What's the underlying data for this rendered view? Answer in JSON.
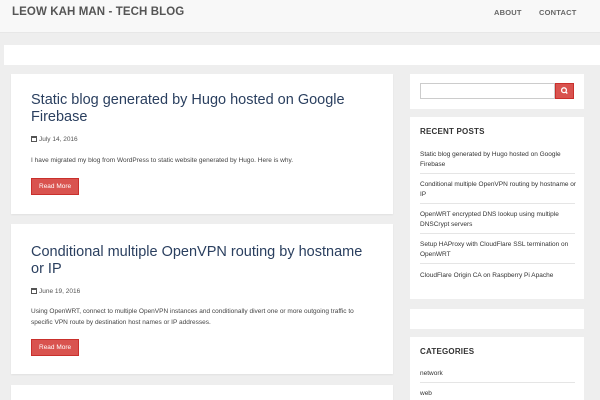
{
  "navbar": {
    "brand": "LEOW KAH MAN - TECH BLOG",
    "links": [
      "ABOUT",
      "CONTACT"
    ]
  },
  "posts": [
    {
      "title": "Static blog generated by Hugo hosted on Google Firebase",
      "date": "July 14, 2016",
      "excerpt": "I have migrated my blog from WordPress to static website generated by Hugo. Here is why.",
      "button": "Read More"
    },
    {
      "title": "Conditional multiple OpenVPN routing by hostname or IP",
      "date": "June 19, 2016",
      "excerpt": "Using OpenWRT, connect to multiple OpenVPN instances and conditionally divert one or more outgoing traffic to specific VPN route by destination host names or IP addresses.",
      "button": "Read More"
    }
  ],
  "sidebar": {
    "search": {
      "placeholder": "",
      "icon": "search-icon"
    },
    "recent_posts": {
      "title": "RECENT POSTS",
      "items": [
        "Static blog generated by Hugo hosted on Google Firebase",
        "Conditional multiple OpenVPN routing by hostname or IP",
        "OpenWRT encrypted DNS lookup using multiple DNSCrypt servers",
        "Setup HAProxy with CloudFlare SSL termination on OpenWRT",
        "CloudFlare Origin CA on Raspberry Pi Apache"
      ]
    },
    "categories": {
      "title": "CATEGORIES",
      "items": [
        "network",
        "web"
      ]
    }
  },
  "colors": {
    "accent": "#d9534f",
    "title": "#2a3f5f",
    "background": "#eeeeee"
  }
}
